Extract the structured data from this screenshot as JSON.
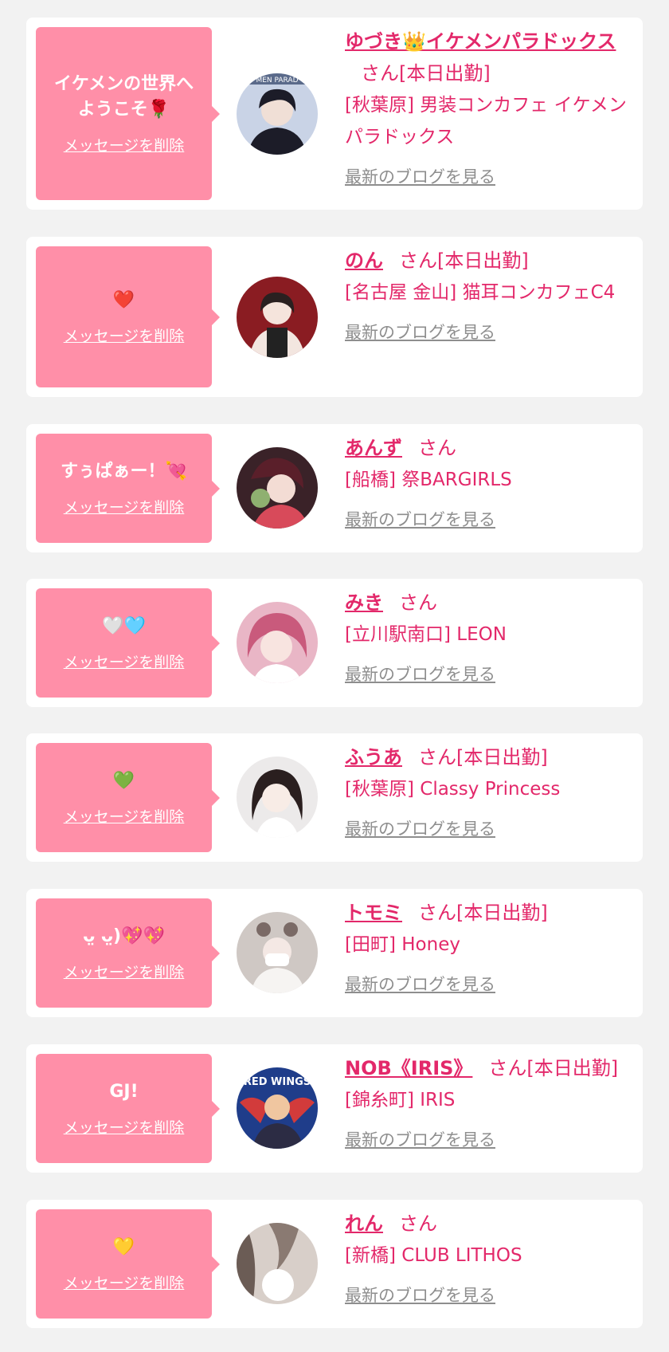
{
  "cards": [
    {
      "message": "イケメンの世界へようこそ🌹",
      "delete_label": "メッセージを削除",
      "name": "ゆづき👑イケメンパラドックス",
      "honorific": "さん[本日出勤]",
      "shop": "[秋葉原] 男装コンカフェ イケメンパラドックス",
      "blog_label": "最新のブログを見る",
      "avatar_icon": "profile-photo-icon",
      "avatar_colors": [
        "#c9d3e6",
        "#1c1c28"
      ],
      "avatar_banner": "MEN PARAD"
    },
    {
      "message": "❤️",
      "delete_label": "メッセージを削除",
      "name": "のん",
      "honorific": "さん[本日出勤]",
      "shop": "[名古屋 金山] 猫耳コンカフェC4",
      "blog_label": "最新のブログを見る",
      "avatar_icon": "profile-photo-icon",
      "avatar_colors": [
        "#8a1c22",
        "#f3e6e0"
      ]
    },
    {
      "message": "すぅぱぁー！💘",
      "delete_label": "メッセージを削除",
      "name": "あんず",
      "honorific": "さん",
      "shop": "[船橋] 祭BARGIRLS",
      "blog_label": "最新のブログを見る",
      "avatar_icon": "profile-photo-icon",
      "avatar_colors": [
        "#3a2228",
        "#d84a5a"
      ]
    },
    {
      "message": "🤍🩵",
      "delete_label": "メッセージを削除",
      "name": "みき",
      "honorific": "さん",
      "shop": "[立川駅南口] LEON",
      "blog_label": "最新のブログを見る",
      "avatar_icon": "profile-photo-icon",
      "avatar_colors": [
        "#e9b6c6",
        "#c95a7c"
      ]
    },
    {
      "message": "💚",
      "delete_label": "メッセージを削除",
      "name": "ふうあ",
      "honorific": "さん[本日出勤]",
      "shop": "[秋葉原] Classy Princess",
      "blog_label": "最新のブログを見る",
      "avatar_icon": "profile-photo-icon",
      "avatar_colors": [
        "#eceaea",
        "#2a1f1f"
      ]
    },
    {
      "message": "ᴗ̤ ᴗ̤)💖💖",
      "delete_label": "メッセージを削除",
      "name": "トモミ",
      "honorific": "さん[本日出勤]",
      "shop": "[田町] Honey",
      "blog_label": "最新のブログを見る",
      "avatar_icon": "profile-photo-icon",
      "avatar_colors": [
        "#cfc8c4",
        "#f6f4f2"
      ]
    },
    {
      "message": "GJ!",
      "delete_label": "メッセージを削除",
      "name": "NOB《IRIS》",
      "honorific": "さん[本日出勤]",
      "shop": "[錦糸町] IRIS",
      "blog_label": "最新のブログを見る",
      "avatar_icon": "profile-photo-icon",
      "avatar_colors": [
        "#1f3d8a",
        "#d23b3b"
      ],
      "avatar_banner": "RED WINGS"
    },
    {
      "message": "💛",
      "delete_label": "メッセージを削除",
      "name": "れん",
      "honorific": "さん",
      "shop": "[新橋] CLUB LITHOS",
      "blog_label": "最新のブログを見る",
      "avatar_icon": "profile-photo-icon",
      "avatar_colors": [
        "#d8cfc9",
        "#6b5c55"
      ]
    }
  ]
}
